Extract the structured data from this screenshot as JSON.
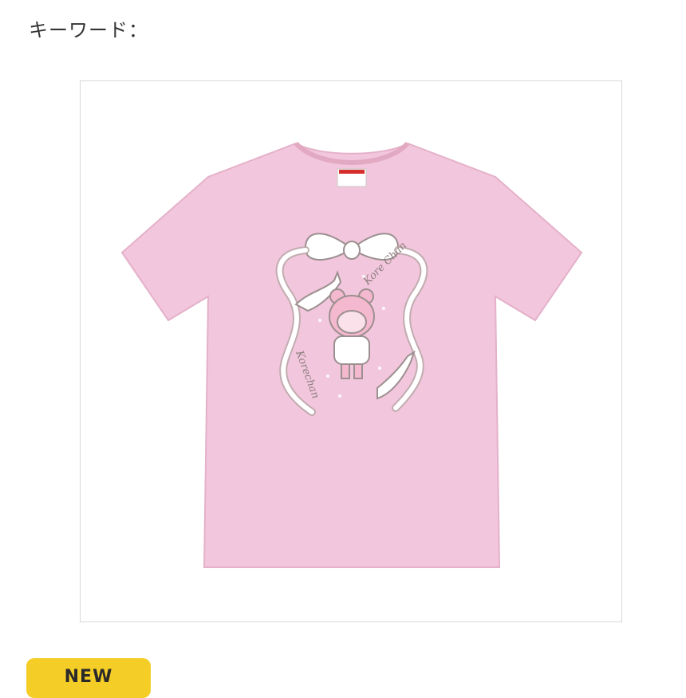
{
  "header": {
    "keyword_label": "キーワード："
  },
  "product": {
    "image_icon": "pink-tshirt-image",
    "shirt_color": "#f2c6dc",
    "print_text_top": "Kore Chan",
    "print_text_left": "Korechan"
  },
  "badge": {
    "label": "NEW",
    "color": "#f4cd26"
  }
}
